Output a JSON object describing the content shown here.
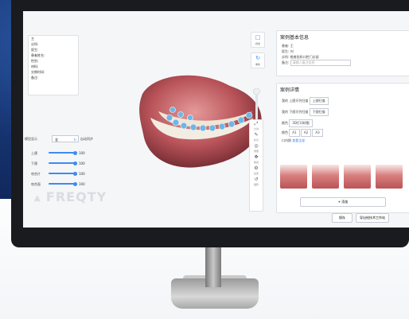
{
  "left_info": {
    "rows": [
      "主",
      "诊所:",
      "医生:",
      "患者姓名:",
      "性别:",
      "材料:",
      "交期时间:",
      "备注:"
    ]
  },
  "controls": {
    "mode_label": "模型显示",
    "mode_value": "全",
    "sync_label": "自动同步",
    "sliders": [
      {
        "label": "上颌",
        "value": 100,
        "text": "100"
      },
      {
        "label": "下颌",
        "value": 100,
        "text": "100"
      },
      {
        "label": "咬合片",
        "value": 100,
        "text": "100"
      },
      {
        "label": "咬合面",
        "value": 100,
        "text": "100"
      }
    ]
  },
  "brand": "FREQTY",
  "top_icons": [
    {
      "name": "视觉",
      "icon": "□"
    },
    {
      "name": "重新",
      "icon": "↻"
    }
  ],
  "tools": [
    {
      "icon": "⤢",
      "label": "分割"
    },
    {
      "icon": "✎",
      "label": "标记"
    },
    {
      "icon": "◎",
      "label": "测量"
    },
    {
      "icon": "✥",
      "label": "移动"
    },
    {
      "icon": "⚙",
      "label": "设置"
    },
    {
      "icon": "↺",
      "label": "旋转"
    }
  ],
  "panel": {
    "basic_title": "案例基本信息",
    "basic_rows": [
      {
        "label": "患者",
        "value": "王"
      },
      {
        "label": "医生",
        "value": "刘"
      },
      {
        "label": "诊所",
        "value": "格睿齿科口腔门诊部"
      }
    ],
    "remark_label": "备注",
    "remark_placeholder": "请输入备注信息",
    "detail_title": "案例详情",
    "upper_label": "我的 上颌牙列扫描",
    "upper_value": "上颌扫描",
    "lower_label": "我的 下颌牙列扫描",
    "lower_value": "下颌扫描",
    "material_label": "颜色",
    "material_value": "3D打印树脂",
    "type_label": "颜色",
    "type_values": [
      "A1",
      "A2",
      "A3"
    ],
    "photos_label": "口内照",
    "photos_link": "查看全部",
    "add_button": "+ 添加",
    "footer_buttons": [
      "保存",
      "导出给技术工作站"
    ]
  }
}
